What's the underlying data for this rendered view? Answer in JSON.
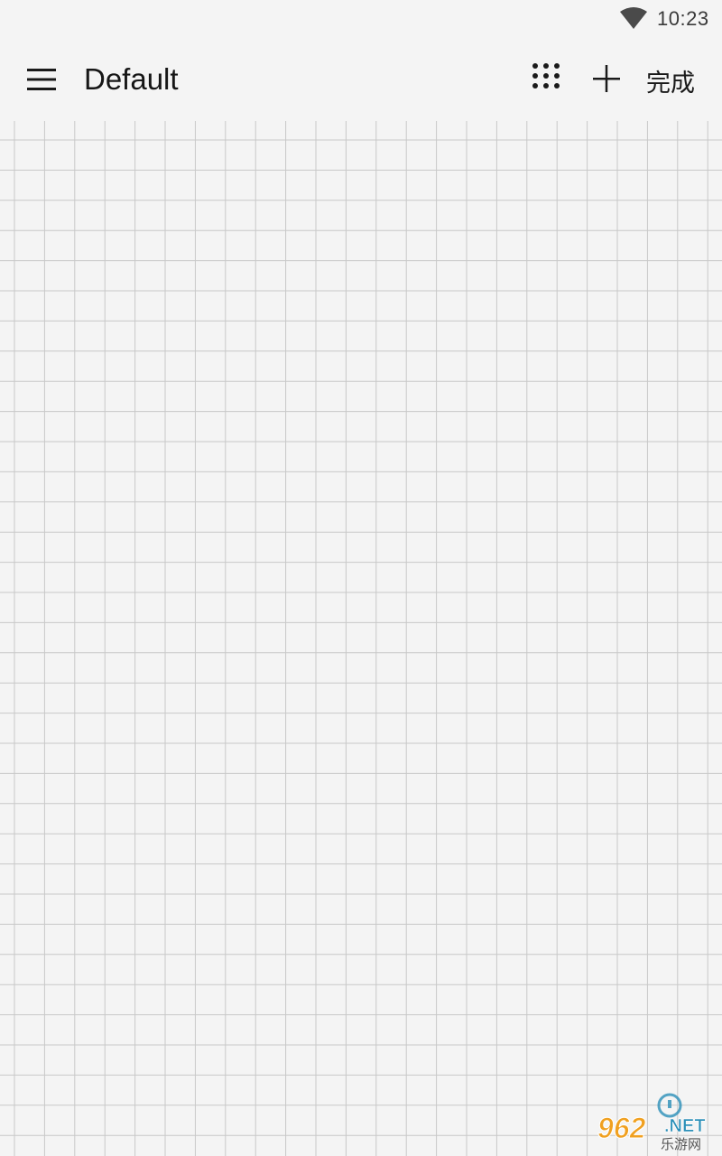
{
  "status_bar": {
    "time": "10:23",
    "wifi_icon": "wifi-icon"
  },
  "toolbar": {
    "menu_icon": "hamburger-menu-icon",
    "title": "Default",
    "grid_icon": "dot-grid-icon",
    "add_icon": "plus-icon",
    "done_label": "完成"
  },
  "canvas": {
    "background": "grid-paper",
    "line_color": "#c8c8c8",
    "background_color": "#f4f4f4"
  },
  "watermark": {
    "logo_text": "962",
    "suffix_text": ".NET",
    "sub_text": "乐游网"
  }
}
